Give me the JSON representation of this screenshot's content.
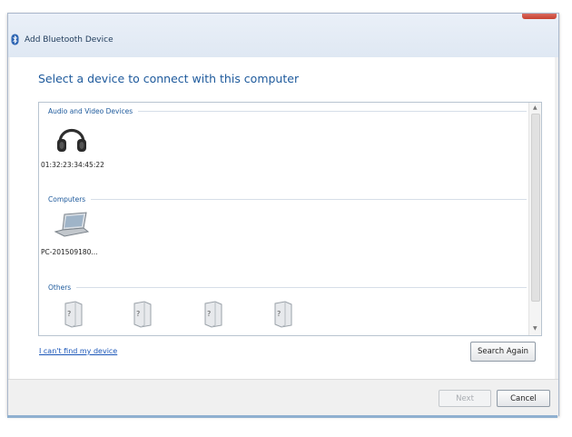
{
  "window": {
    "title": "Add Bluetooth Device"
  },
  "main": {
    "heading": "Select a device to connect with this computer",
    "groups": [
      {
        "label": "Audio and Video Devices",
        "devices": [
          {
            "name": "01:32:23:34:45:22",
            "icon": "headphones-icon"
          }
        ]
      },
      {
        "label": "Computers",
        "devices": [
          {
            "name": "PC-201509180...",
            "icon": "laptop-icon"
          }
        ]
      },
      {
        "label": "Others",
        "devices": [
          {
            "name": "",
            "icon": "unknown-device-icon"
          },
          {
            "name": "",
            "icon": "unknown-device-icon"
          },
          {
            "name": "",
            "icon": "unknown-device-icon"
          },
          {
            "name": "",
            "icon": "unknown-device-icon"
          }
        ]
      }
    ],
    "help_link": "I can't find my device",
    "search_again": "Search Again"
  },
  "footer": {
    "next": "Next",
    "cancel": "Cancel"
  },
  "colors": {
    "accent": "#1e5a9c",
    "link": "#1a56b8"
  }
}
